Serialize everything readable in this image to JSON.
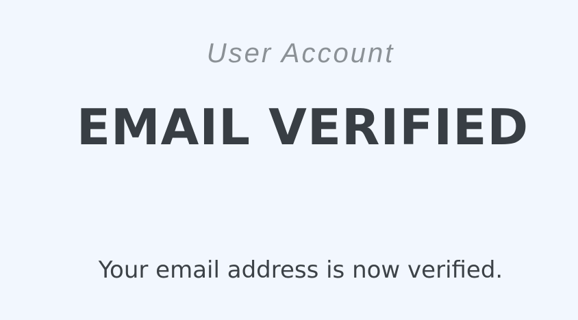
{
  "header": {
    "subtitle": "User Account",
    "title": "EMAIL VERIFIED"
  },
  "main": {
    "message": "Your email address is now verified."
  },
  "colors": {
    "background": "#f2f7fe",
    "subtitle_text": "#8b9196",
    "title_text": "#383e44",
    "body_text": "#3c4247"
  }
}
